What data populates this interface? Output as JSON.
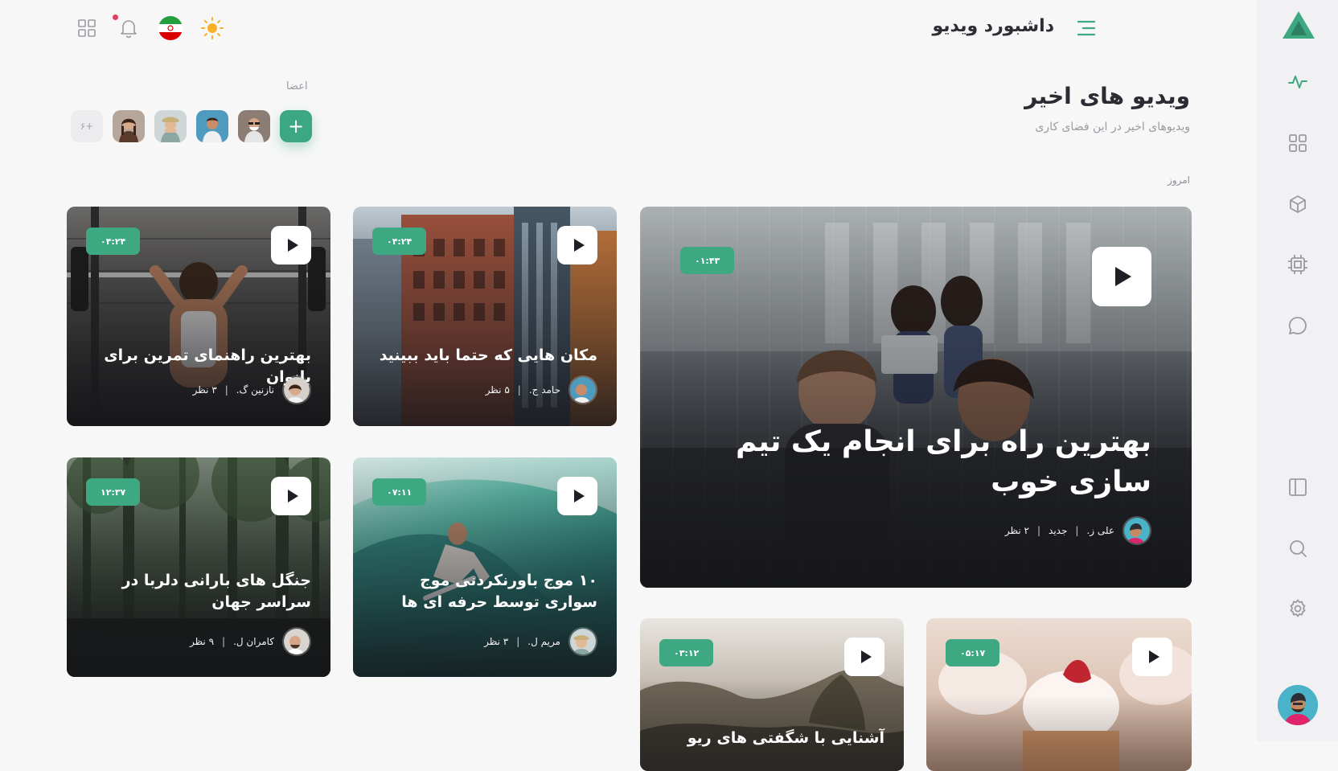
{
  "header": {
    "title": "داشبورد ویدیو"
  },
  "members": {
    "label": "اعضا",
    "more": "۶+",
    "add": "+"
  },
  "section": {
    "title": "ویدیو های اخیر",
    "subtitle": "ویدیوهای اخیر در این فضای کاری",
    "group_label": "امروز"
  },
  "featured": {
    "duration": "۰۱:۴۳",
    "title": "بهترین راه برای انجام یک تیم سازی خوب",
    "author": "علی ز.",
    "tag": "جدید",
    "views": "۲ نظر"
  },
  "cards": [
    {
      "duration": "۰۴:۲۴",
      "title": "مکان هایی که حتما باید ببینید",
      "author": "حامد ج.",
      "views": "۵ نظر"
    },
    {
      "duration": "۰۴:۲۴",
      "title": "بهترین راهنمای تمرین برای بانوان",
      "author": "نازنین گ.",
      "views": "۳ نظر"
    },
    {
      "duration": "۰۷:۱۱",
      "title": "۱۰ موج باورنکردنی موج سواری توسط حرفه ای ها",
      "author": "مریم ل.",
      "views": "۳ نظر"
    },
    {
      "duration": "۱۲:۳۷",
      "title": "جنگل های بارانی دلربا در سراسر جهان",
      "author": "کامران ل.",
      "views": "۹ نظر"
    },
    {
      "duration": "۰۳:۱۲",
      "title": "آشنایی با شگفتی های ریو",
      "author": "",
      "views": ""
    },
    {
      "duration": "۰۵:۱۷",
      "title": "",
      "author": "",
      "views": ""
    }
  ],
  "separator": "|",
  "colors": {
    "accent": "#3ea883",
    "notification": "#e23c5f"
  },
  "icons": {
    "rail": [
      "logo-icon",
      "activity-icon",
      "grid-icon",
      "cube-icon",
      "chip-icon",
      "chat-icon",
      "panel-icon",
      "search-icon",
      "settings-icon"
    ],
    "top": [
      "apps-icon",
      "bell-icon",
      "iran-flag-icon",
      "sun-icon",
      "menu-icon"
    ]
  }
}
